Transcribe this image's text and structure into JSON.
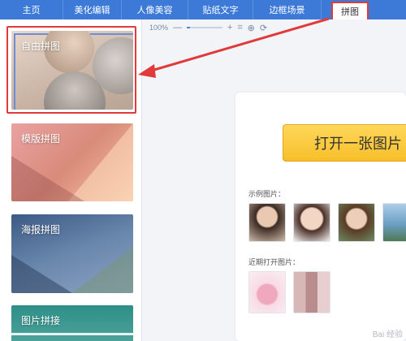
{
  "nav": {
    "tabs": [
      {
        "label": "主页"
      },
      {
        "label": "美化编辑"
      },
      {
        "label": "人像美容"
      },
      {
        "label": "贴纸文字"
      },
      {
        "label": "边框场景"
      },
      {
        "label": "拼图"
      }
    ],
    "active_index": 5
  },
  "sidebar": {
    "items": [
      {
        "label": "自由拼图"
      },
      {
        "label": "模版拼图"
      },
      {
        "label": "海报拼图"
      },
      {
        "label": "图片拼接"
      }
    ],
    "selected_index": 0
  },
  "zoom": {
    "value": "100%",
    "minus": "—",
    "plus": "+",
    "level": 0.1
  },
  "main": {
    "open_button_label": "打开一张图片",
    "sample_label": "示例图片：",
    "recent_label": "近期打开图片："
  },
  "watermark": "Bai 经验",
  "colors": {
    "nav_bg": "#3d7ad8",
    "highlight_red": "#e03a3a",
    "button_yellow": "#f7bf2a"
  }
}
